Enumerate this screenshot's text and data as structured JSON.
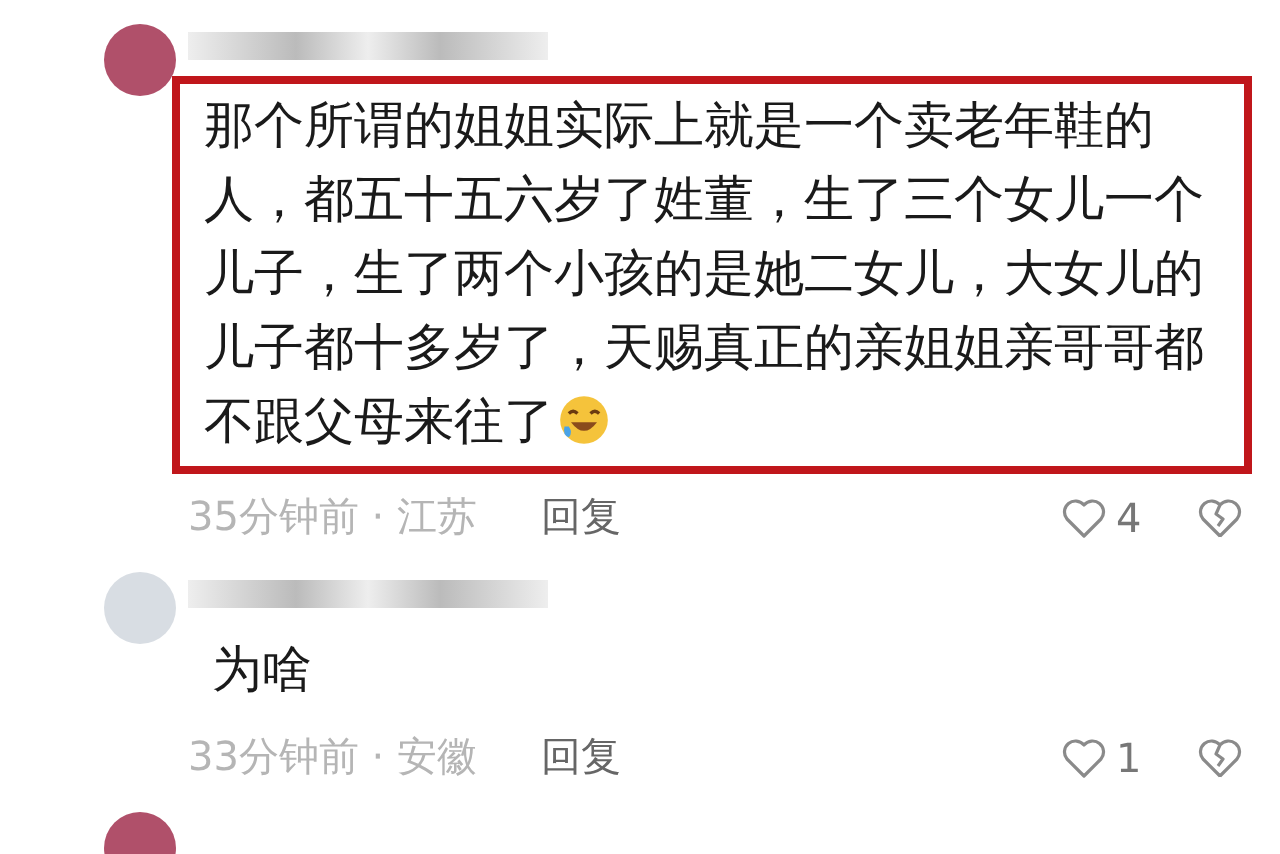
{
  "comments": [
    {
      "body": "那个所谓的姐姐实际上就是一个卖老年鞋的人，都五十五六岁了姓董，生了三个女儿一个儿子，生了两个小孩的是她二女儿，大女儿的儿子都十多岁了，天赐真正的亲姐姐亲哥哥都不跟父母来往了",
      "highlighted": true,
      "time_location": "35分钟前 · 江苏",
      "reply": "回复",
      "like_count": "4"
    },
    {
      "body": "为啥",
      "highlighted": false,
      "time_location": "33分钟前 · 安徽",
      "reply": "回复",
      "like_count": "1"
    }
  ]
}
